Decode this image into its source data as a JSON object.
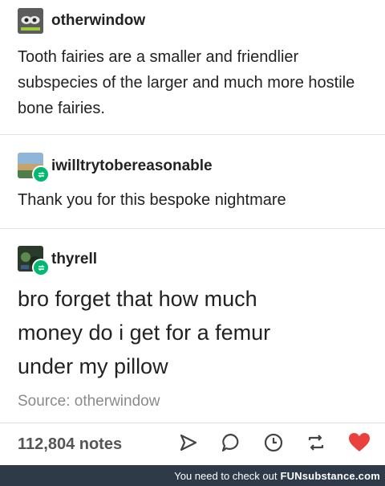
{
  "posts": [
    {
      "username": "otherwindow",
      "text": "Tooth fairies are a smaller and friendlier subspecies of the larger and much more hostile bone fairies."
    },
    {
      "username": "iwilltrytobereasonable",
      "text": "Thank you for this bespoke nightmare"
    },
    {
      "username": "thyrell",
      "text": "bro forget that how much money do i get for a femur under my pillow"
    }
  ],
  "source": "Source: otherwindow",
  "notes": "112,804 notes",
  "actions": [
    "share-icon",
    "reply-icon",
    "history-icon",
    "reblog-icon",
    "like-icon"
  ],
  "colors": {
    "reblog_badge": "#00b870",
    "like_heart": "#e9413e",
    "footer_bg": "#2f3a49"
  },
  "footer": {
    "prefix": "You need to check out",
    "brand": "FUNsubstance.com"
  }
}
